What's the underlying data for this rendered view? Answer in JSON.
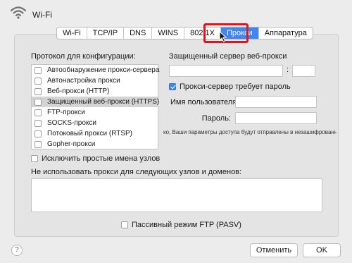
{
  "window": {
    "title": "Wi-Fi"
  },
  "tabs": [
    {
      "label": "Wi-Fi"
    },
    {
      "label": "TCP/IP"
    },
    {
      "label": "DNS"
    },
    {
      "label": "WINS"
    },
    {
      "label": "802.1X"
    },
    {
      "label": "Прокси",
      "active": true
    },
    {
      "label": "Аппаратура"
    }
  ],
  "protocols": {
    "header": "Протокол для конфигурации:",
    "items": [
      {
        "label": "Автообнаружение прокси-сервера",
        "checked": false
      },
      {
        "label": "Автонастройка прокси",
        "checked": false
      },
      {
        "label": "Веб-прокси (HTTP)",
        "checked": false
      },
      {
        "label": "Защищенный веб-прокси (HTTPS)",
        "checked": false,
        "selected": true
      },
      {
        "label": "FTP-прокси",
        "checked": false
      },
      {
        "label": "SOCKS-прокси",
        "checked": false
      },
      {
        "label": "Потоковый прокси (RTSP)",
        "checked": false
      },
      {
        "label": "Gopher-прокси",
        "checked": false
      }
    ]
  },
  "server": {
    "header": "Защищенный сервер веб-прокси",
    "host_value": "",
    "port_value": "",
    "colon": ":",
    "requires_password_label": "Прокси-сервер требует пароль",
    "requires_password_checked": true,
    "username_label": "Имя пользователя:",
    "username_value": "",
    "password_label": "Пароль:",
    "password_value": "",
    "note": "ко, Ваши параметры доступа будут отправлены в незашифрованно"
  },
  "exclude_simple": {
    "label": "Исключить простые имена узлов",
    "checked": false
  },
  "bypass": {
    "label": "Не использовать прокси для следующих узлов и доменов:",
    "value": ""
  },
  "passive_ftp": {
    "label": "Пассивный режим FTP (PASV)",
    "checked": false
  },
  "footer": {
    "help": "?",
    "cancel_label": "Отменить",
    "ok_label": "OK"
  }
}
